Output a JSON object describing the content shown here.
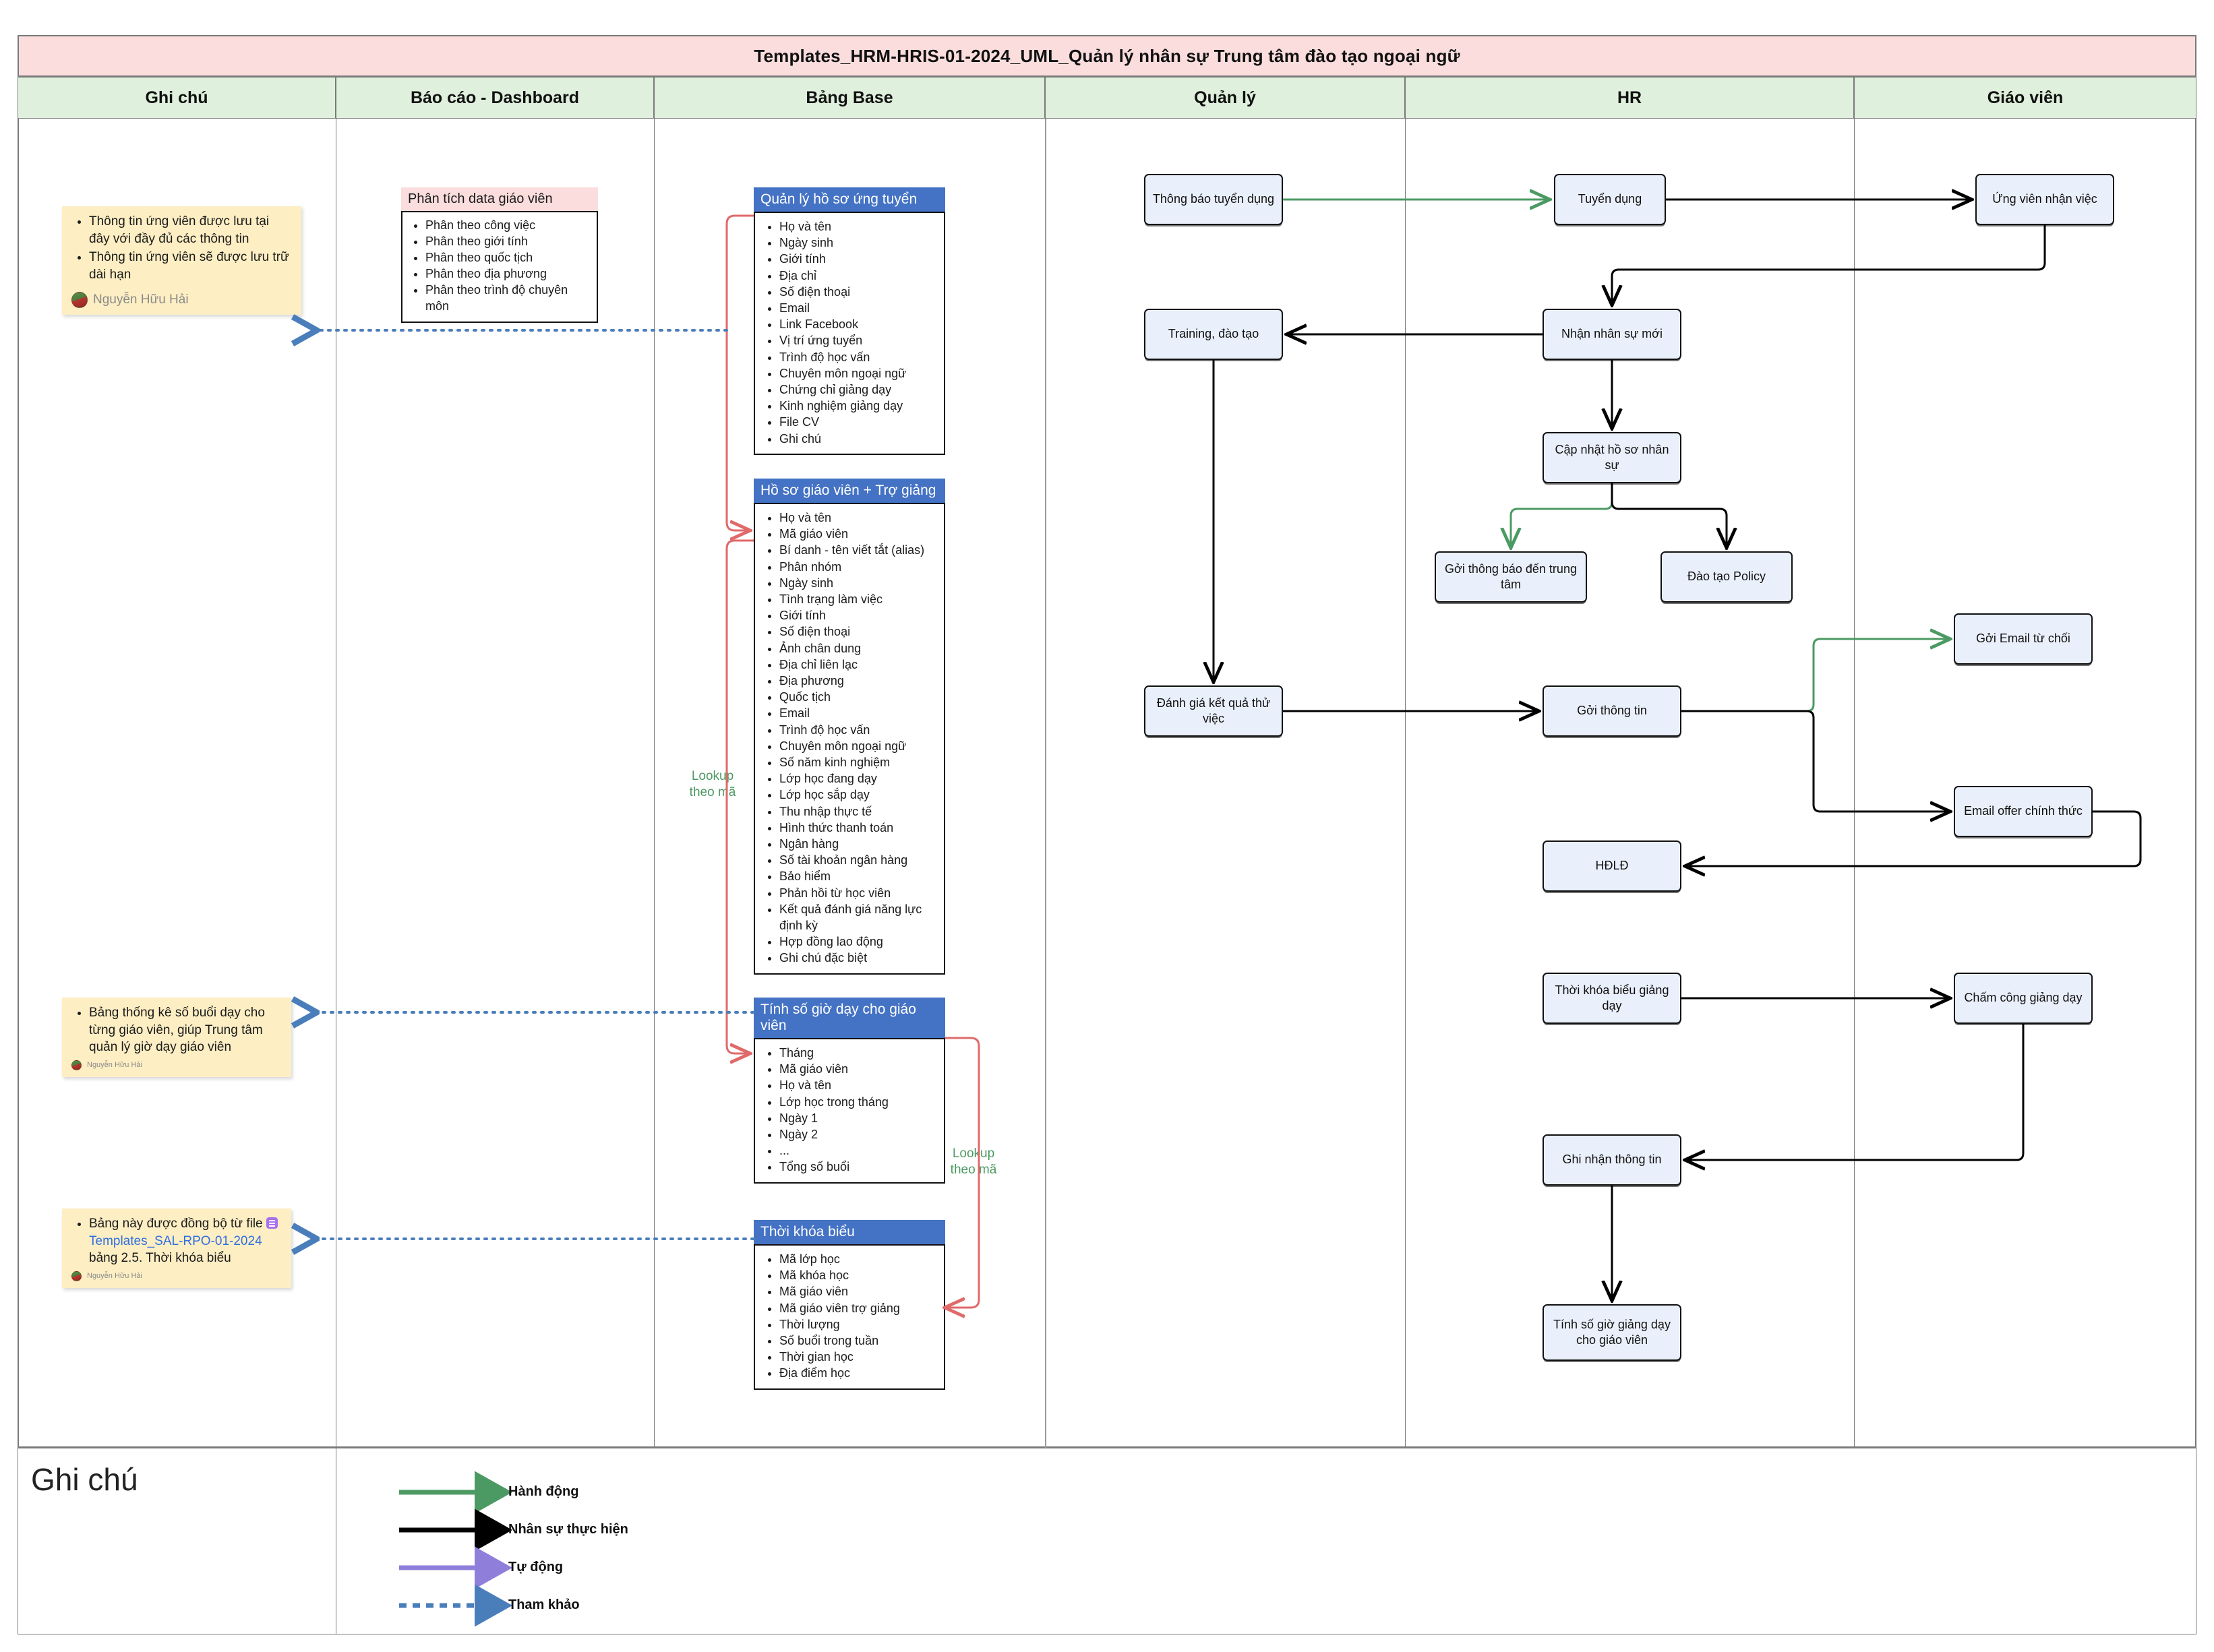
{
  "document": {
    "title": "Templates_HRM-HRIS-01-2024_UML_Quản lý nhân sự Trung tâm đào tạo ngoại ngữ"
  },
  "colors": {
    "title_bar": "#fbdddd",
    "lane_header": "#dff0dc",
    "table_header": "#4472c4",
    "process_fill": "#eaf0fb",
    "note_fill": "#fdeec3",
    "action_arrow": "#4c9a63",
    "staff_arrow": "#000000",
    "auto_arrow": "#8f7fdb",
    "reference_arrow": "#4a7ebb",
    "lookup_line": "#e06a6a",
    "lookup_label": "#4c9a63",
    "link_text": "#2f6fe0"
  },
  "lanes": [
    {
      "id": "ghi-chu",
      "label": "Ghi chú"
    },
    {
      "id": "bao-cao-dashboard",
      "label": "Báo cáo - Dashboard"
    },
    {
      "id": "bang-base",
      "label": "Bảng Base"
    },
    {
      "id": "quan-ly",
      "label": "Quản lý"
    },
    {
      "id": "hr",
      "label": "HR"
    },
    {
      "id": "giao-vien",
      "label": "Giáo viên"
    }
  ],
  "notes": [
    {
      "id": "note-ung-vien",
      "items": [
        "Thông tin ứng viên được lưu tại đây với đầy đủ các thông tin",
        "Thông tin ứng viên sẽ được lưu trữ dài hạn"
      ],
      "author": "Nguyễn Hữu Hải"
    },
    {
      "id": "note-thong-ke",
      "items": [
        "Bảng thống kê số buổi dạy cho từng giáo viên, giúp Trung tâm quản lý giờ dạy giáo viên"
      ],
      "author": "Nguyễn Hữu Hải"
    },
    {
      "id": "note-dong-bo",
      "items": [],
      "text_before": "Bảng này được đồng bộ từ file ",
      "link": "Templates_SAL-RPO-01-2024",
      "text_after": " bảng 2.5. Thời khóa biểu",
      "author": "Nguyễn Hữu Hải"
    }
  ],
  "report_card": {
    "title": "Phân tích data giáo viên",
    "items": [
      "Phân theo công việc",
      "Phân theo giới tính",
      "Phân theo quốc tịch",
      "Phân theo địa phương",
      "Phân theo trình độ chuyên môn"
    ]
  },
  "base_tables": [
    {
      "id": "quan-ly-ho-so-ung-tuyen",
      "title": "Quản lý hồ sơ ứng tuyển",
      "fields": [
        "Họ và tên",
        "Ngày sinh",
        "Giới tính",
        "Địa chỉ",
        "Số điện thoại",
        "Email",
        "Link Facebook",
        "Vị trí ứng tuyển",
        "Trình độ học vấn",
        "Chuyên môn ngoại ngữ",
        "Chứng chỉ giảng dạy",
        "Kinh nghiệm giảng dạy",
        "File CV",
        "Ghi chú"
      ]
    },
    {
      "id": "ho-so-giao-vien-tro-giang",
      "title": "Hồ sơ giáo viên + Trợ giảng",
      "fields": [
        "Họ và tên",
        "Mã giáo viên",
        "Bí danh - tên viết tắt (alias)",
        "Phân nhóm",
        "Ngày sinh",
        "Tình trạng làm việc",
        "Giới tính",
        "Số điện thoại",
        "Ảnh chân dung",
        "Địa chỉ liên lạc",
        "Địa phương",
        "Quốc tịch",
        "Email",
        "Trình độ học vấn",
        "Chuyên môn ngoại ngữ",
        "Số năm kinh nghiệm",
        "Lớp học đang dạy",
        "Lớp học sắp dạy",
        "Thu nhập thực tế",
        "Hình thức thanh toán",
        "Ngân hàng",
        "Số tài khoản ngân hàng",
        "Bảo hiểm",
        "Phản hồi từ học viên",
        "Kết quả đánh giá năng lực định kỳ",
        "Hợp đồng lao động",
        "Ghi chú đặc biệt"
      ]
    },
    {
      "id": "tinh-so-gio-day-cho-giao-vien",
      "title": "Tính số giờ dạy cho giáo viên",
      "fields": [
        "Tháng",
        "Mã giáo viên",
        "Họ và tên",
        "Lớp học trong tháng",
        "Ngày 1",
        "Ngày 2",
        "...",
        "Tổng số buổi"
      ]
    },
    {
      "id": "thoi-khoa-bieu",
      "title": "Thời khóa biểu",
      "fields": [
        "Mã lớp học",
        "Mã khóa học",
        "Mã giáo viên",
        "Mã giáo viên trợ giảng",
        "Thời lượng",
        "Số buổi trong tuần",
        "Thời gian học",
        "Địa điểm học"
      ]
    }
  ],
  "lookup_labels": [
    {
      "id": "lookup-1",
      "text_line1": "Lookup",
      "text_line2": "theo mã"
    },
    {
      "id": "lookup-2",
      "text_line1": "Lookup",
      "text_line2": "theo mã"
    }
  ],
  "process_boxes": [
    {
      "id": "thong-bao-tuyen-dung",
      "label": "Thông báo tuyển dụng",
      "lane": "quan-ly"
    },
    {
      "id": "tuyen-dung",
      "label": "Tuyển dụng",
      "lane": "hr"
    },
    {
      "id": "ung-vien-nhan-viec",
      "label": "Ứng viên nhận việc",
      "lane": "giao-vien"
    },
    {
      "id": "training-dao-tao",
      "label": "Training, đào tạo",
      "lane": "quan-ly"
    },
    {
      "id": "nhan-nhan-su-moi",
      "label": "Nhận nhân sự mới",
      "lane": "hr"
    },
    {
      "id": "cap-nhat-ho-so-nhan-su",
      "label": "Cập nhật hồ sơ nhân sự",
      "lane": "hr"
    },
    {
      "id": "goi-thong-bao-den-trung-tam",
      "label": "Gởi thông báo đến trung tâm",
      "lane": "hr"
    },
    {
      "id": "dao-tao-policy",
      "label": "Đào tạo Policy",
      "lane": "hr"
    },
    {
      "id": "danh-gia-ket-qua-thu-viec",
      "label": "Đánh giá kết quả thử việc",
      "lane": "quan-ly"
    },
    {
      "id": "goi-thong-tin",
      "label": "Gởi thông tin",
      "lane": "hr"
    },
    {
      "id": "goi-email-tu-choi",
      "label": "Gởi Email từ chối",
      "lane": "giao-vien"
    },
    {
      "id": "email-offer-chinh-thuc",
      "label": "Email offer chính thức",
      "lane": "giao-vien"
    },
    {
      "id": "hdld",
      "label": "HĐLĐ",
      "lane": "hr"
    },
    {
      "id": "thoi-khoa-bieu-giang-day",
      "label": "Thời khóa biểu giảng dạy",
      "lane": "hr"
    },
    {
      "id": "cham-cong-giang-day",
      "label": "Chấm công giảng dạy",
      "lane": "giao-vien"
    },
    {
      "id": "ghi-nhan-thong-tin",
      "label": "Ghi nhận thông tin",
      "lane": "hr"
    },
    {
      "id": "tinh-so-gio-giang-day",
      "label": "Tính số giờ giảng dạy cho giáo viên",
      "lane": "hr"
    }
  ],
  "legend": {
    "title": "Ghi chú",
    "entries": [
      {
        "id": "legend-hanh-dong",
        "label": "Hành động",
        "color": "#4c9a63",
        "style": "solid"
      },
      {
        "id": "legend-nhan-su-thuc-hien",
        "label": "Nhân sự thực hiện",
        "color": "#000000",
        "style": "solid"
      },
      {
        "id": "legend-tu-dong",
        "label": "Tự động",
        "color": "#8f7fdb",
        "style": "solid"
      },
      {
        "id": "legend-tham-khao",
        "label": "Tham khảo",
        "color": "#4a7ebb",
        "style": "dotted"
      }
    ]
  }
}
